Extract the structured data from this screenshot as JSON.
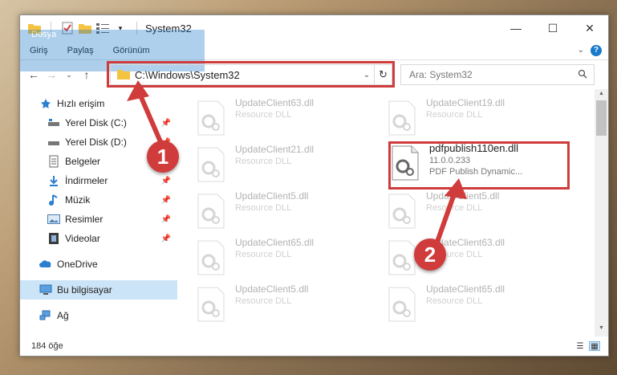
{
  "window": {
    "title": "System32",
    "controls": [
      "minimize-icon",
      "maximize-icon",
      "close-icon"
    ]
  },
  "ribbon": {
    "tabs": [
      {
        "label": "Dosya"
      },
      {
        "label": "Giriş"
      },
      {
        "label": "Paylaş"
      },
      {
        "label": "Görünüm"
      }
    ]
  },
  "address": {
    "path": "C:\\Windows\\System32",
    "search_placeholder": "Ara: System32"
  },
  "sidebar": {
    "items": [
      {
        "label": "Hızlı erişim",
        "icon": "star-icon",
        "pinned": false
      },
      {
        "label": "Yerel Disk (C:)",
        "icon": "drive-icon",
        "pinned": true
      },
      {
        "label": "Yerel Disk (D:)",
        "icon": "drive-icon",
        "pinned": true
      },
      {
        "label": "Belgeler",
        "icon": "documents-icon",
        "pinned": true
      },
      {
        "label": "İndirmeler",
        "icon": "download-icon",
        "pinned": true
      },
      {
        "label": "Müzik",
        "icon": "music-icon",
        "pinned": true
      },
      {
        "label": "Resimler",
        "icon": "pictures-icon",
        "pinned": true
      },
      {
        "label": "Videolar",
        "icon": "video-icon",
        "pinned": true
      },
      {
        "label": "OneDrive",
        "icon": "cloud-icon",
        "pinned": false
      },
      {
        "label": "Bu bilgisayar",
        "icon": "computer-icon",
        "pinned": false,
        "selected": true
      },
      {
        "label": "Ağ",
        "icon": "network-icon",
        "pinned": false
      }
    ]
  },
  "files": [
    {
      "name": "UpdateClient63.dll",
      "desc": "Resource DLL"
    },
    {
      "name": "UpdateClient19.dll",
      "desc": "Resource DLL"
    },
    {
      "name": "UpdateClient21.dll",
      "desc": "Resource DLL"
    },
    {
      "name": "pdfpublish110en.dll",
      "version": "11.0.0.233",
      "desc": "PDF Publish Dynamic...",
      "highlighted": true
    },
    {
      "name": "UpdateClient5.dll",
      "desc": "Resource DLL"
    },
    {
      "name": "UpdateClient5.dll",
      "desc": "Resource DLL"
    },
    {
      "name": "UpdateClient65.dll",
      "desc": "Resource DLL"
    },
    {
      "name": "UpdateClient63.dll",
      "desc": "Resource DLL"
    },
    {
      "name": "UpdateClient5.dll",
      "desc": "Resource DLL"
    },
    {
      "name": "UpdateClient65.dll",
      "desc": "Resource DLL"
    }
  ],
  "status": {
    "count": "184 öğe"
  },
  "annotations": [
    {
      "number": "1"
    },
    {
      "number": "2"
    }
  ],
  "colors": {
    "accent": "#1979ca",
    "highlight": "#d03b3b",
    "selection": "#cce4f7"
  }
}
